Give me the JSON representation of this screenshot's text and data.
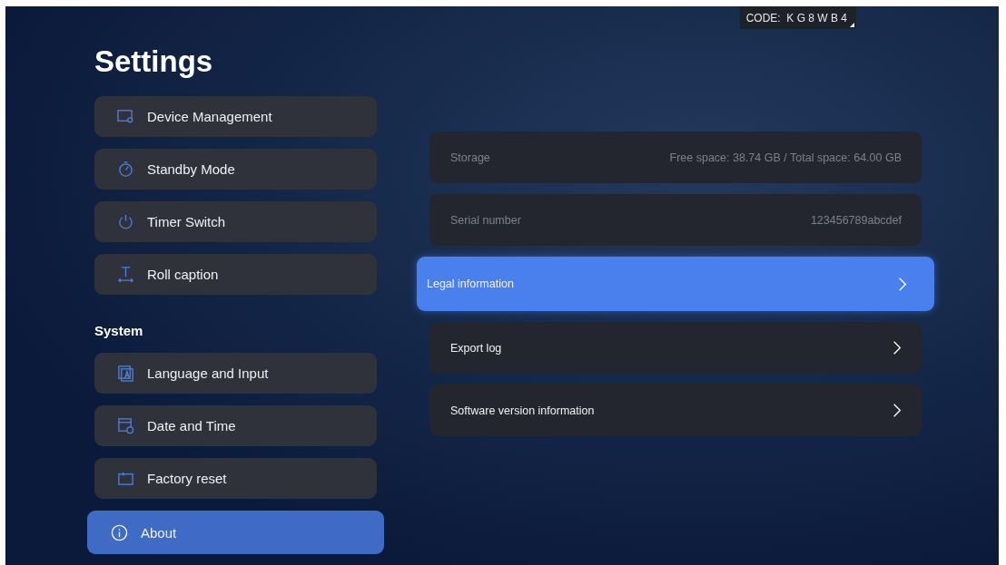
{
  "code_badge": "CODE:  K G 8 W B 4",
  "title": "Settings",
  "menu_groups": [
    {
      "items": [
        {
          "label": "Device Management",
          "selected": false
        },
        {
          "label": "Standby Mode",
          "selected": false
        },
        {
          "label": "Timer Switch",
          "selected": false
        },
        {
          "label": "Roll caption",
          "selected": false
        }
      ]
    },
    {
      "heading": "System",
      "items": [
        {
          "label": "Language and Input",
          "selected": false
        },
        {
          "label": "Date and Time",
          "selected": false
        },
        {
          "label": "Factory reset",
          "selected": false
        },
        {
          "label": "About",
          "selected": true
        }
      ]
    }
  ],
  "about_rows": [
    {
      "kind": "info",
      "label": "Storage",
      "value": "Free space: 38.74 GB / Total space: 64.00 GB",
      "selected": false
    },
    {
      "kind": "info",
      "label": "Serial number",
      "value": "123456789abcdef",
      "selected": false
    },
    {
      "kind": "link",
      "label": "Legal information",
      "selected": true
    },
    {
      "kind": "link",
      "label": "Export log",
      "selected": false
    },
    {
      "kind": "link",
      "label": "Software version information",
      "selected": false
    }
  ]
}
